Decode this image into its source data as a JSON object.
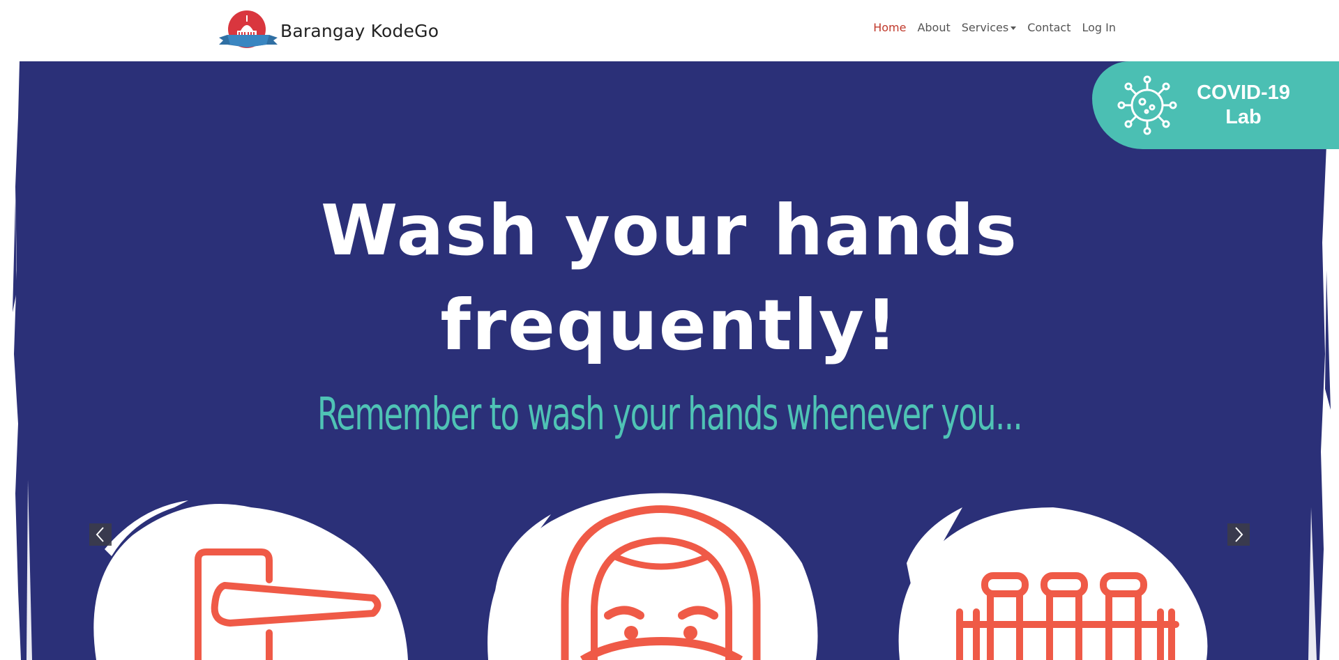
{
  "brand": {
    "name": "Barangay KodeGo",
    "logo_icon": "capitol-building-logo-icon"
  },
  "nav": {
    "items": [
      {
        "label": "Home",
        "active": true
      },
      {
        "label": "About",
        "active": false
      },
      {
        "label": "Services",
        "active": false,
        "dropdown": true
      },
      {
        "label": "Contact",
        "active": false
      },
      {
        "label": "Log In",
        "active": false
      }
    ]
  },
  "hero": {
    "title_line1": "Wash your hands",
    "title_line2": "frequently!",
    "subtitle": "Remember to wash your hands whenever you...",
    "background_color": "#2b3078",
    "accent_color": "#4fc3b5",
    "icon_color": "#ef5a47"
  },
  "covid_badge": {
    "line1": "COVID-19",
    "line2": "Lab",
    "icon": "virus-icon",
    "color": "#4bbfb3"
  },
  "carousel": {
    "prev_icon": "chevron-left-icon",
    "next_icon": "chevron-right-icon"
  },
  "icons": [
    "door-handle-icon",
    "face-mask-icon",
    "shopping-cart-icon"
  ]
}
